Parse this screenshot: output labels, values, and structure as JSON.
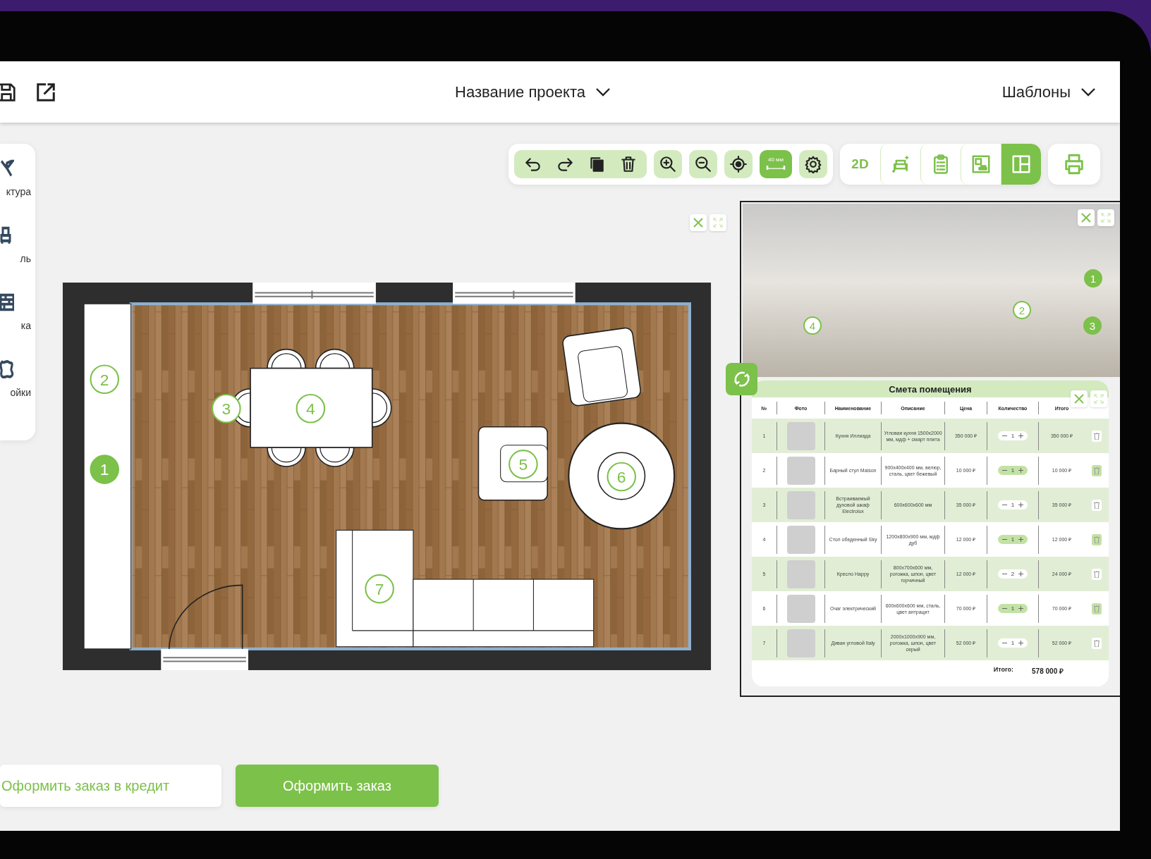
{
  "header": {
    "project_title": "Название проекта",
    "templates": "Шаблоны"
  },
  "sidebar": {
    "items": [
      {
        "kind": "tools",
        "label": "ктура"
      },
      {
        "kind": "furniture",
        "label": "ль"
      },
      {
        "kind": "brick",
        "label": "ка"
      },
      {
        "kind": "material",
        "label": "ойки"
      }
    ]
  },
  "toolbar": {
    "tools": [
      {
        "kind": "undo",
        "active": false
      },
      {
        "kind": "redo",
        "active": false
      },
      {
        "kind": "copy",
        "active": false
      },
      {
        "kind": "delete",
        "active": false
      },
      {
        "kind": "zoom_in",
        "active": false
      },
      {
        "kind": "zoom_out",
        "active": false
      },
      {
        "kind": "center",
        "active": false
      },
      {
        "kind": "ruler",
        "label": "40 мм",
        "active": true
      },
      {
        "kind": "settings",
        "active": false
      }
    ],
    "views": [
      {
        "kind": "flat",
        "label": "2D",
        "selected": false
      },
      {
        "kind": "furnish",
        "selected": false
      },
      {
        "kind": "list",
        "selected": false
      },
      {
        "kind": "render",
        "selected": false
      },
      {
        "kind": "split",
        "selected": true
      }
    ]
  },
  "plan": {
    "markers": [
      {
        "label": "1",
        "filled": true
      },
      {
        "label": "2",
        "filled": false
      },
      {
        "label": "3",
        "filled": false
      },
      {
        "label": "4",
        "filled": false
      },
      {
        "label": "5",
        "filled": false
      },
      {
        "label": "6",
        "filled": false
      },
      {
        "label": "7",
        "filled": false
      }
    ]
  },
  "render": {
    "markers": [
      {
        "label": "1",
        "filled": true
      },
      {
        "label": "2",
        "filled": false
      },
      {
        "label": "3",
        "filled": true
      },
      {
        "label": "4",
        "filled": false
      }
    ]
  },
  "estimate": {
    "title": "Смета помещения",
    "columns": [
      "№",
      "Фото",
      "Наименование",
      "Описание",
      "Цена",
      "Количество",
      "Итого"
    ],
    "rows": [
      {
        "number": "1",
        "name": "Кухня Иллиада",
        "description": "Угловая кухня 1500x2000 мм, мдф + смарт плита",
        "price": "350 000 ₽",
        "quantity": "1",
        "total": "350 000 ₽"
      },
      {
        "number": "2",
        "name": "Барный стул Maison",
        "description": "900x400x400 мм, велюр, сталь, цвет бежевый",
        "price": "10 000 ₽",
        "quantity": "1",
        "total": "10 000 ₽"
      },
      {
        "number": "3",
        "name": "Встраиваемый духовой шкаф Electrolux",
        "description": "600x600x600 мм",
        "price": "35 000 ₽",
        "quantity": "1",
        "total": "35 000 ₽"
      },
      {
        "number": "4",
        "name": "Стол обеденный Sky",
        "description": "1200x800x900 мм, мдф дуб",
        "price": "12 000 ₽",
        "quantity": "1",
        "total": "12 000 ₽"
      },
      {
        "number": "5",
        "name": "Кресло Happy",
        "description": "800x700x600 мм, рогожка, шпон, цвет горчичный",
        "price": "12 000 ₽",
        "quantity": "2",
        "total": "24 000 ₽"
      },
      {
        "number": "6",
        "name": "Очаг электрический",
        "description": "600x600x600 мм, сталь, цвет антрацит",
        "price": "70 000 ₽",
        "quantity": "1",
        "total": "70 000 ₽"
      },
      {
        "number": "7",
        "name": "Диван угловой Italy",
        "description": "2000x1000x900 мм, рогожка, шпон, цвет серый",
        "price": "52 000 ₽",
        "quantity": "1",
        "total": "52 000 ₽"
      }
    ],
    "total_label": "Итого:",
    "total_value": "578 000 ₽"
  },
  "actions": [
    {
      "kind": "secondary",
      "label": "Оформить заказ в кредит"
    },
    {
      "kind": "primary",
      "label": "Оформить заказ"
    }
  ]
}
